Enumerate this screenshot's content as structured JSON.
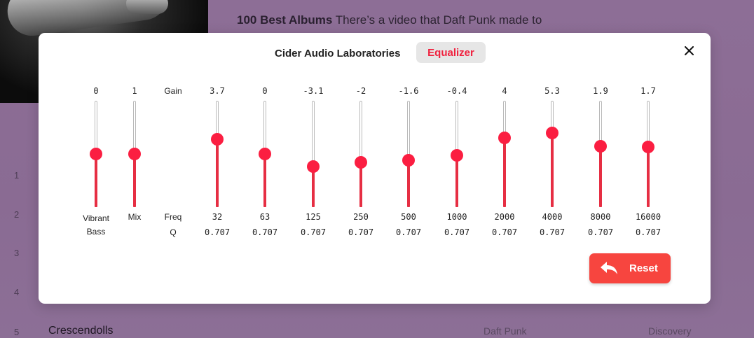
{
  "background": {
    "description_bold": "100 Best Albums",
    "description": " There’s a video that Daft Punk made to",
    "track_numbers": [
      "1",
      "2",
      "3",
      "4",
      "5"
    ],
    "visible_track": {
      "number": "5",
      "title": "Crescendolls",
      "artist": "Daft Punk",
      "album": "Discovery"
    }
  },
  "modal": {
    "tab_label": "Cider Audio Laboratories",
    "active_tab": "Equalizer",
    "close_icon": "close-icon",
    "gain_label": "Gain",
    "freq_label": "Freq",
    "q_label": "Q",
    "controls": [
      {
        "name": "Vibrant Bass",
        "line1": "Vibrant",
        "line2": "Bass",
        "value": "0",
        "level": 0.5
      },
      {
        "name": "Mix",
        "line1": "Mix",
        "value": "1",
        "level": 0.5
      }
    ],
    "bands": [
      {
        "freq": "32",
        "gain": "3.7",
        "q": "0.707"
      },
      {
        "freq": "63",
        "gain": "0",
        "q": "0.707"
      },
      {
        "freq": "125",
        "gain": "-3.1",
        "q": "0.707"
      },
      {
        "freq": "250",
        "gain": "-2",
        "q": "0.707"
      },
      {
        "freq": "500",
        "gain": "-1.6",
        "q": "0.707"
      },
      {
        "freq": "1000",
        "gain": "-0.4",
        "q": "0.707"
      },
      {
        "freq": "2000",
        "gain": "4",
        "q": "0.707"
      },
      {
        "freq": "4000",
        "gain": "5.3",
        "q": "0.707"
      },
      {
        "freq": "8000",
        "gain": "1.9",
        "q": "0.707"
      },
      {
        "freq": "16000",
        "gain": "1.7",
        "q": "0.707"
      }
    ],
    "gain_range": [
      -12,
      12
    ],
    "reset_label": "Reset",
    "reset_icon": "undo-arrow-icon",
    "accent_color": "#fb1e41",
    "reset_color": "#f7453f"
  }
}
